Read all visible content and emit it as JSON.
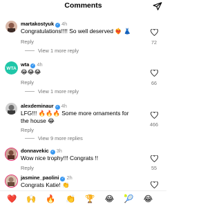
{
  "header": {
    "title": "Comments",
    "send_icon": "send-icon"
  },
  "comments": [
    {
      "username": "martakostyuk",
      "time": "4h",
      "text": "Congratulations!!!! So well deserved ❤️‍🔥 👗",
      "reply": "Reply",
      "view_replies": "View 1 more reply",
      "likes": "72",
      "avatar_color": "#8a5a4a"
    },
    {
      "username": "wta",
      "time": "4h",
      "text": "😂😂😂",
      "reply": "Reply",
      "view_replies": "View 1 more reply",
      "likes": "66",
      "avatar_color": "#1fc6a8"
    },
    {
      "username": "alexdeminaur",
      "time": "4h",
      "text": "LFG!!! 🔥🔥🔥 Some more ornaments for the house 😂",
      "reply": "Reply",
      "view_replies": "View 9 more replies",
      "likes": "466",
      "avatar_color": "#6d6d6d"
    },
    {
      "username": "donnavekic",
      "time": "3h",
      "text": "Wow nice trophy!!! Congrats !!",
      "reply": "Reply",
      "view_replies": "",
      "likes": "55",
      "avatar_color": "#7a4b3c"
    },
    {
      "username": "jasmine_paolini",
      "time": "2h",
      "text": "Congrats Katie! 👏",
      "reply": "",
      "view_replies": "",
      "likes": "",
      "avatar_color": "#9a7a6a"
    }
  ],
  "emoji_bar": [
    "❤️",
    "🙌",
    "🔥",
    "👏",
    "🏆",
    "😂",
    "🎾",
    "😂"
  ]
}
